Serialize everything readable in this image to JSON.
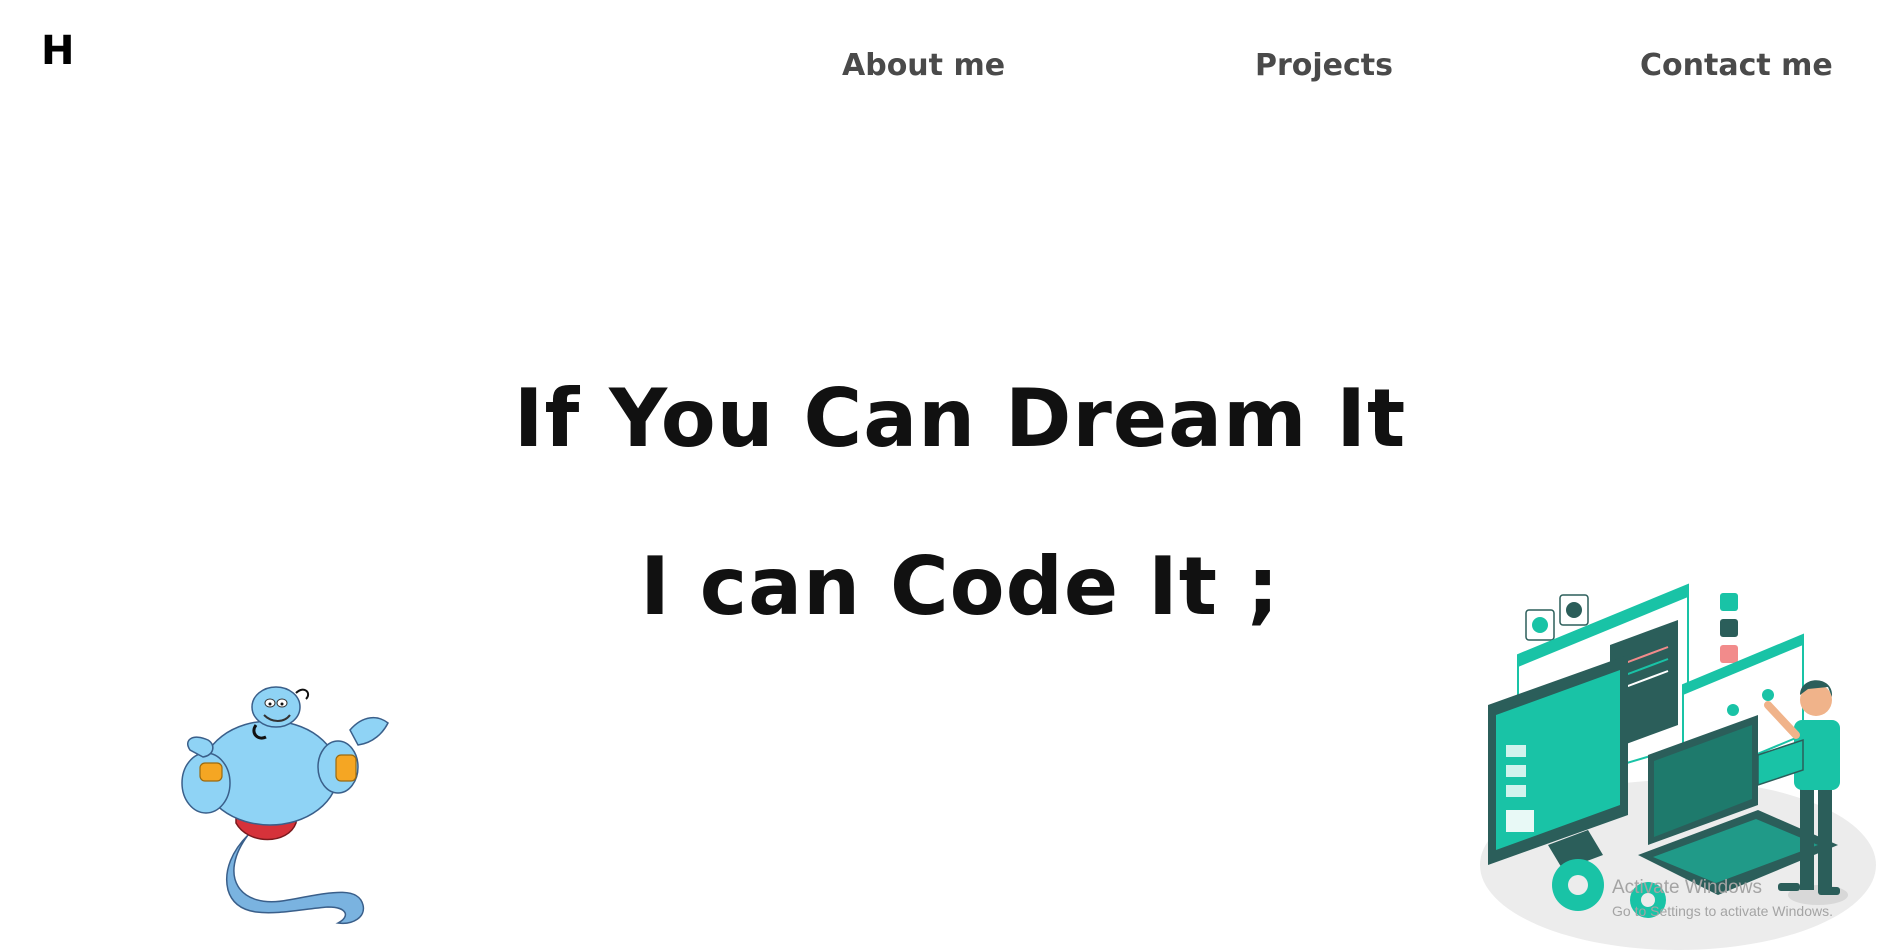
{
  "header": {
    "logo": "H",
    "nav": [
      "About me",
      "Projects",
      "Contact me"
    ]
  },
  "hero": {
    "line1": "If You Can Dream It",
    "line2": "I can Code It ;"
  },
  "images": {
    "left": "genie-illustration",
    "right": "developer-illustration"
  },
  "watermark": {
    "title": "Activate Windows",
    "subtitle": "Go to Settings to activate Windows."
  },
  "colors": {
    "accent": "#19c3a6",
    "dark_teal": "#2b5e5a",
    "genie_blue": "#8fd3f5",
    "nav_text": "#4a4a4a"
  }
}
